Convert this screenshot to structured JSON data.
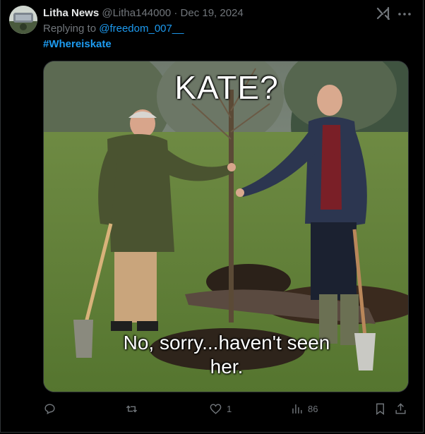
{
  "post": {
    "author_name": "Litha News",
    "author_handle": "@Litha144000",
    "separator": "·",
    "date": "Dec 19, 2024",
    "replying_prefix": "Replying to",
    "replying_to": "@freedom_007__",
    "hashtag": "#Whereiskate",
    "media": {
      "caption_top": "KATE?",
      "caption_bottom_line1": "No, sorry...haven't seen",
      "caption_bottom_line2": "her."
    },
    "actions": {
      "reply_count": "",
      "repost_count": "",
      "like_count": "1",
      "views_count": "86"
    }
  },
  "icons": [
    "grok-icon",
    "more-icon",
    "reply-icon",
    "repost-icon",
    "like-icon",
    "views-icon",
    "bookmark-icon",
    "share-icon"
  ],
  "colors": {
    "background": "#000000",
    "text": "#e7e9ea",
    "muted": "#71767b",
    "link": "#1d9bf0",
    "border": "#2f3336"
  }
}
